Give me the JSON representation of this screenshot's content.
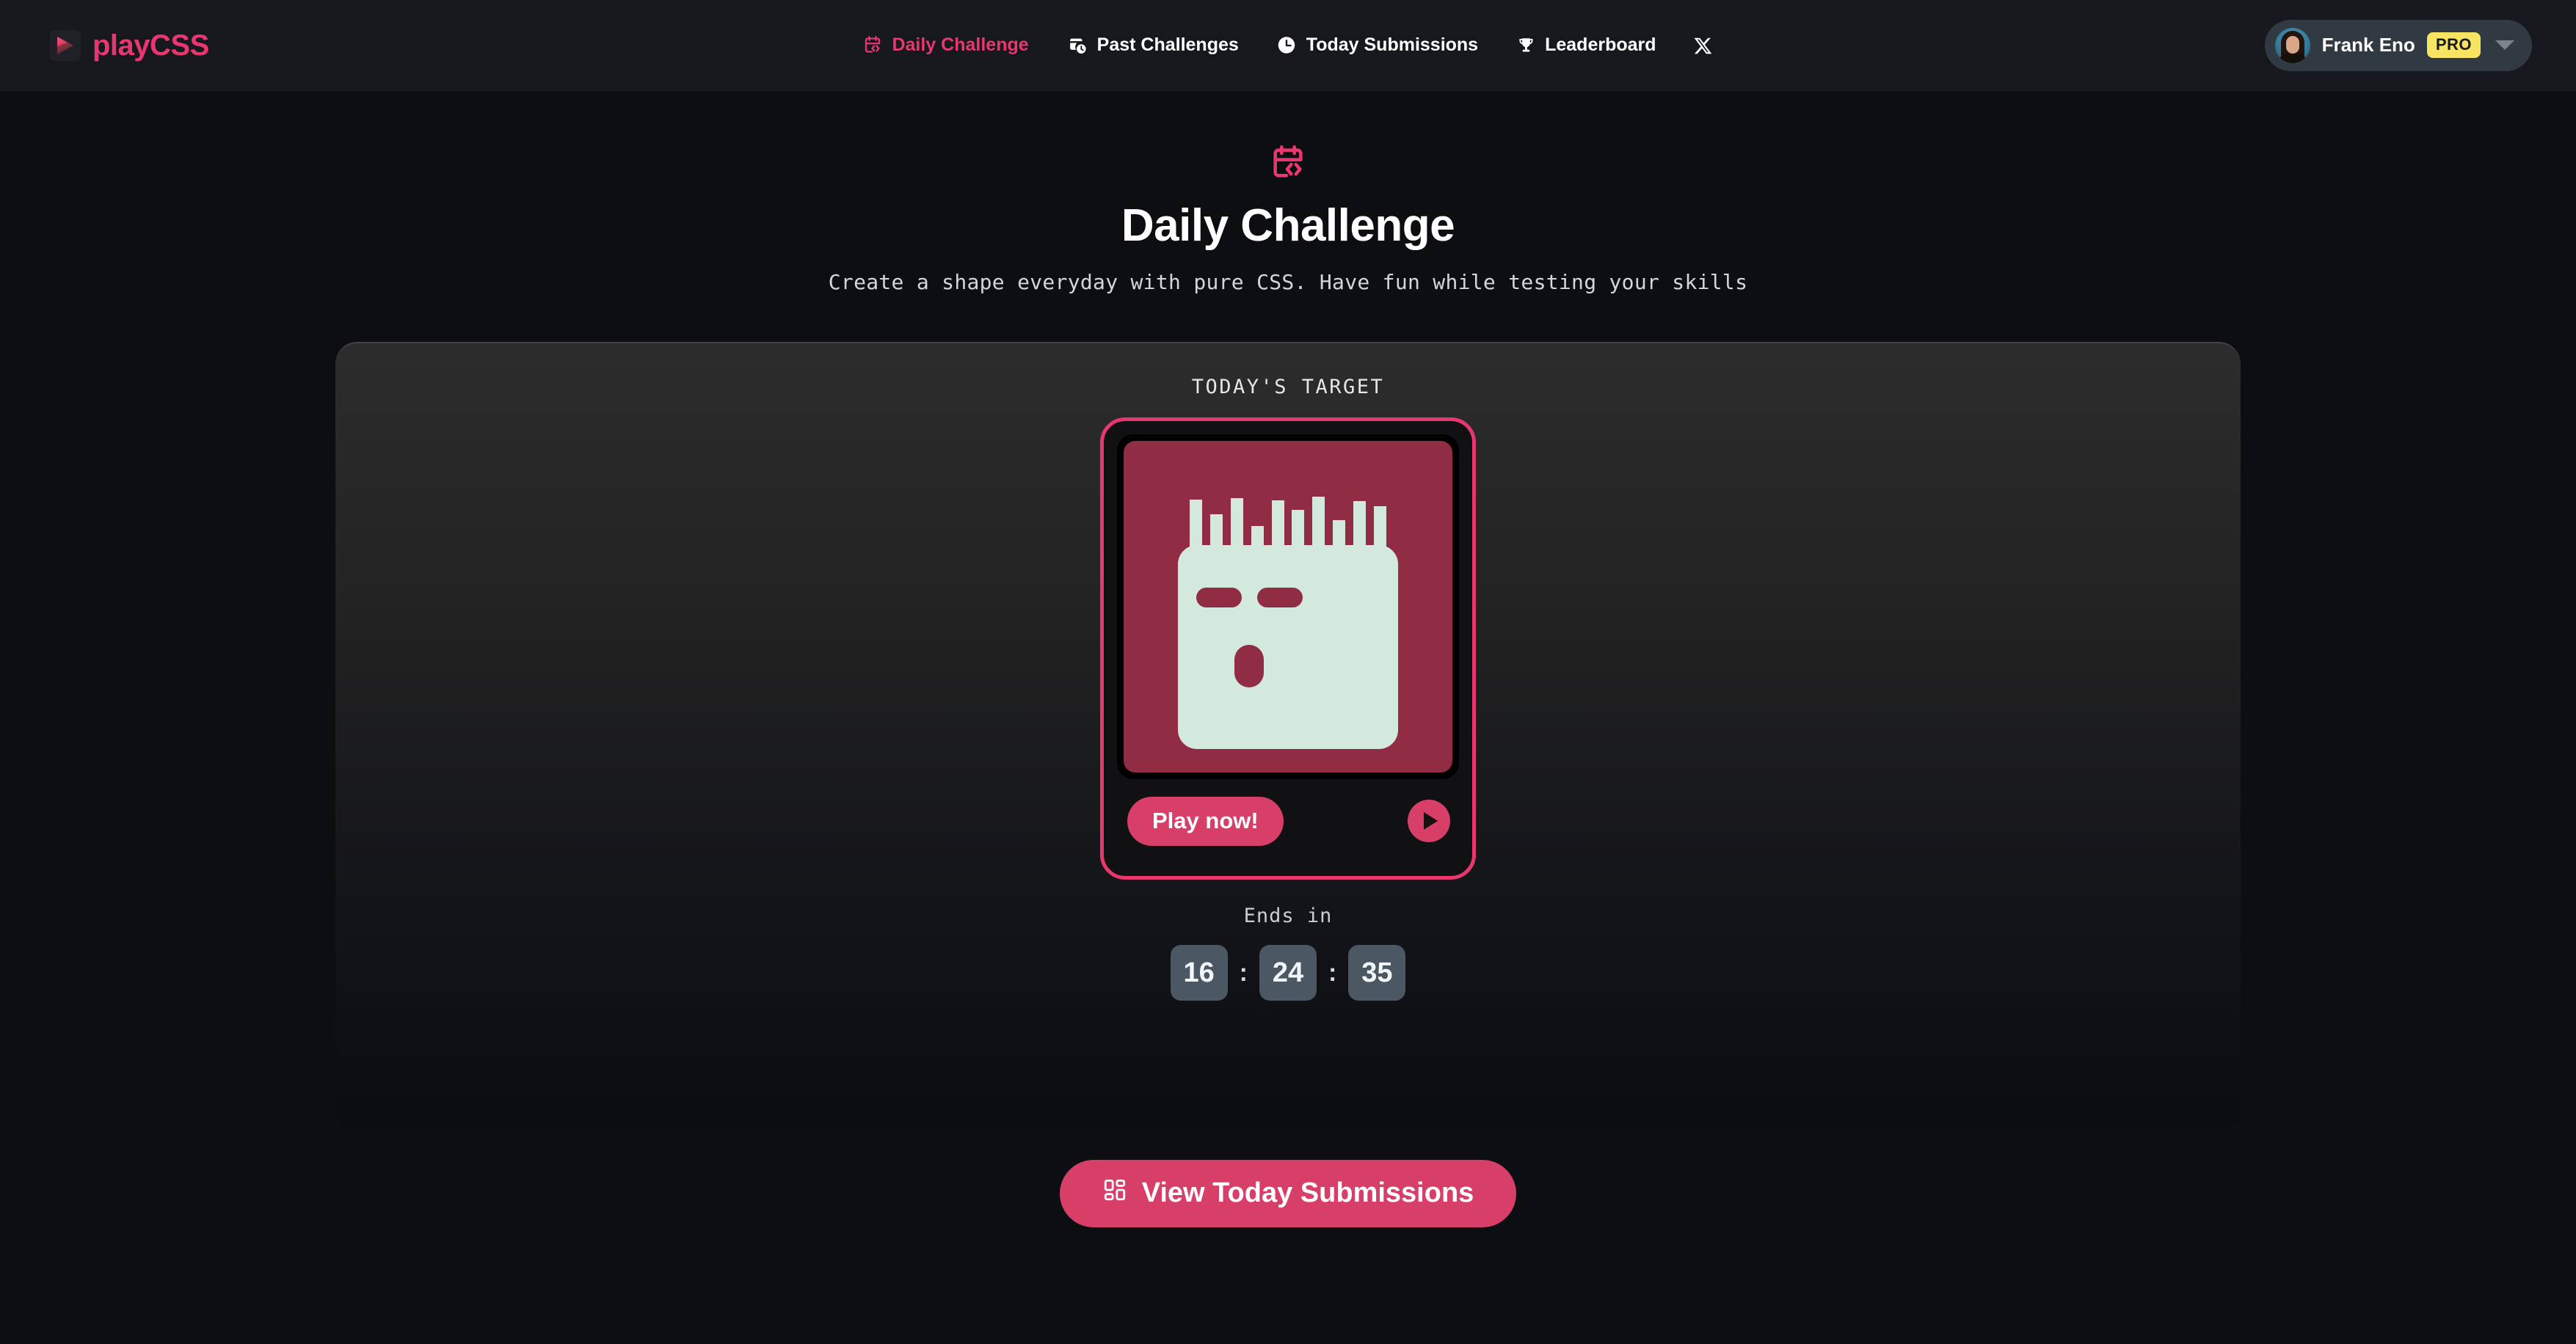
{
  "brand": {
    "name": "playCSS",
    "logo_icon": "play-triangle-icon"
  },
  "nav": {
    "items": [
      {
        "label": "Daily Challenge",
        "icon": "calendar-code-icon",
        "active": true
      },
      {
        "label": "Past Challenges",
        "icon": "calendar-clock-icon",
        "active": false
      },
      {
        "label": "Today Submissions",
        "icon": "clock-icon",
        "active": false
      },
      {
        "label": "Leaderboard",
        "icon": "trophy-icon",
        "active": false
      }
    ],
    "social": {
      "icon": "x-twitter-icon",
      "label": "X"
    }
  },
  "user": {
    "name": "Frank Eno",
    "badge": "PRO",
    "avatar_icon": "user-avatar",
    "caret_icon": "chevron-down-icon"
  },
  "hero": {
    "icon": "calendar-code-icon",
    "title": "Daily Challenge",
    "subtitle": "Create a shape everyday with pure CSS. Have fun while testing your skills"
  },
  "panel": {
    "target_label": "TODAY'S TARGET",
    "card": {
      "play_label": "Play now!",
      "play_icon": "play-icon",
      "shape": {
        "name": "spiky-head-face",
        "canvas_color": "#902c44",
        "shape_color": "#d3e9de",
        "spike_heights": [
          72,
          52,
          74,
          36,
          71,
          58,
          76,
          44,
          70,
          63
        ],
        "features": [
          "eye-left",
          "eye-right",
          "mouth"
        ]
      }
    },
    "ends_in_label": "Ends in",
    "countdown": {
      "hours": "16",
      "minutes": "24",
      "seconds": "35",
      "separator": ":"
    }
  },
  "cta": {
    "label": "View Today Submissions",
    "icon": "layout-dashboard-icon"
  },
  "colors": {
    "accent_pink": "#e8376f",
    "button_pink": "#d83f68",
    "pro_yellow": "#f7e463",
    "countdown_slate": "#4b5864",
    "page_bg": "#0c0e12",
    "nav_bg": "#16181d"
  }
}
